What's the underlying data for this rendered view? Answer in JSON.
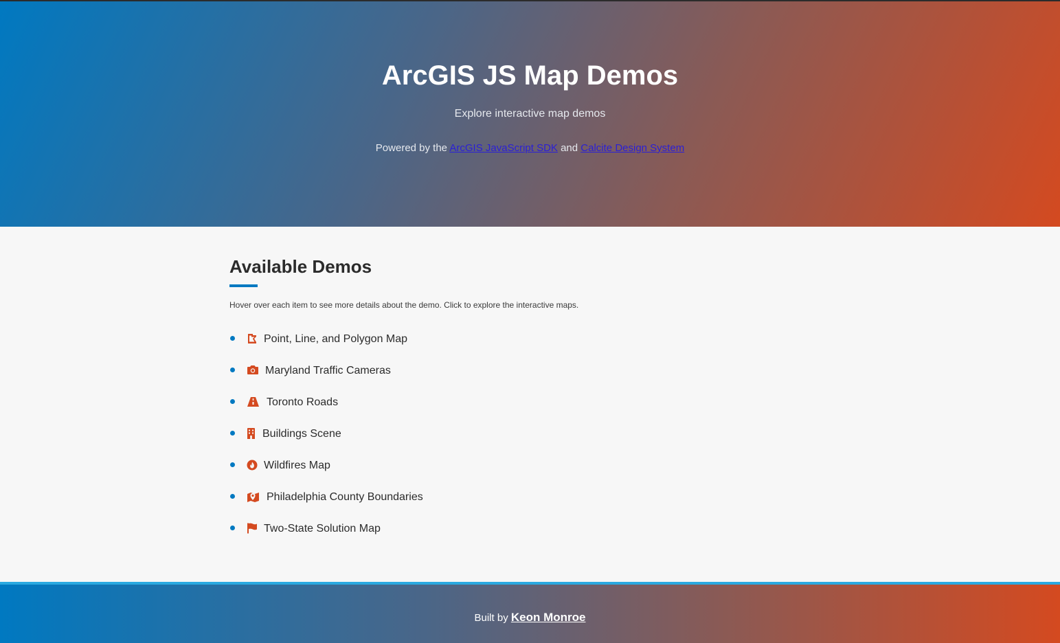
{
  "hero": {
    "title": "ArcGIS JS Map Demos",
    "subtitle": "Explore interactive map demos",
    "powered_prefix": "Powered by the",
    "sdk_link": "ArcGIS JavaScript SDK",
    "and_text": "and",
    "calcite_link": "Calcite Design System"
  },
  "main": {
    "title": "Available Demos",
    "intro": "Hover over each item to see more details about the demo. Click to explore the interactive maps.",
    "demos": [
      {
        "label": "Point, Line, and Polygon Map",
        "icon": "polygon-icon"
      },
      {
        "label": "Maryland Traffic Cameras",
        "icon": "camera-icon"
      },
      {
        "label": "Toronto Roads",
        "icon": "road-icon"
      },
      {
        "label": "Buildings Scene",
        "icon": "building-icon"
      },
      {
        "label": "Wildfires Map",
        "icon": "fire-icon"
      },
      {
        "label": "Philadelphia County Boundaries",
        "icon": "map-marker-icon"
      },
      {
        "label": "Two-State Solution Map",
        "icon": "flag-icon"
      }
    ]
  },
  "footer": {
    "built_by": "Built by",
    "author": "Keon Monroe"
  },
  "colors": {
    "accent_blue": "#0079c1",
    "icon_orange": "#d44a20",
    "footer_border": "#2aa9e0"
  }
}
